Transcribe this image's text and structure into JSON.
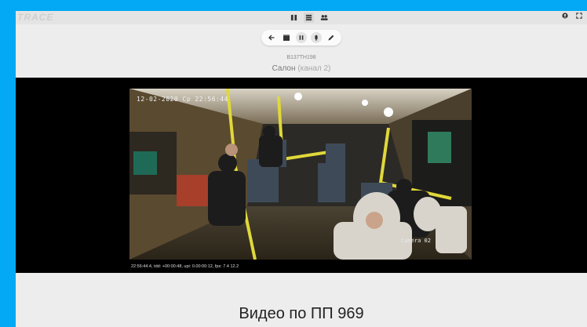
{
  "app": {
    "logo": "TRACE"
  },
  "top_nav": {
    "items": [
      {
        "icon": "map-icon",
        "active": false
      },
      {
        "icon": "list-icon",
        "active": true
      },
      {
        "icon": "people-icon",
        "active": false
      }
    ]
  },
  "top_right": {
    "account_icon": "account-icon",
    "fullscreen_icon": "fullscreen-icon"
  },
  "player_toolbar": {
    "buttons": [
      "back-icon",
      "clapperboard-icon",
      "pause-icon",
      "microphone-icon",
      "pencil-icon"
    ]
  },
  "video": {
    "vehicle_id": "В137ТН198",
    "channel_name": "Салон",
    "channel_sub": "(канал 2)",
    "osd_timestamp": "12-02-2020 Ср 22:56:44",
    "osd_camera": "Camera 02",
    "status_line": "22:56:44.4, tdd: +00:00:48, upi: 0.00:00:12, fps: 7.4   12.2"
  },
  "page": {
    "heading": "Видео по ПП 969"
  },
  "colors": {
    "frame_accent": "#03a9f4",
    "page_bg": "#ededed",
    "video_bg": "#000000"
  }
}
